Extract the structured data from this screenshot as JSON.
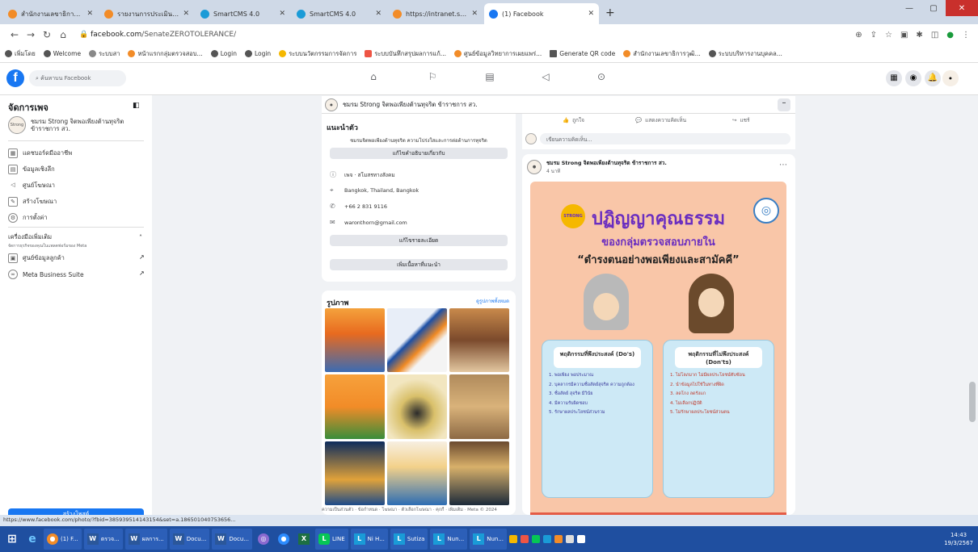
{
  "browser": {
    "tabs": [
      {
        "label": "สำนักงานเลขาธิการวุฒิสภา",
        "color": "#f28c28"
      },
      {
        "label": "รายงานการประเมินคุณธรรมและความโปร่งใส 2567",
        "color": "#f28c28"
      },
      {
        "label": "SmartCMS 4.0",
        "color": "#1a9bd7"
      },
      {
        "label": "SmartCMS 4.0",
        "color": "#1a9bd7"
      },
      {
        "label": "https://intranet.senate.go.th/...",
        "color": "#f28c28"
      },
      {
        "label": "(1) Facebook",
        "color": "#1877f2"
      }
    ],
    "url_domain": "facebook.com",
    "url_path": "/SenateZEROTOLERANCE/",
    "bookmarks": [
      {
        "label": "เพิ่มโดย",
        "color": "#555"
      },
      {
        "label": "Welcome",
        "color": "#555"
      },
      {
        "label": "ระบบสา",
        "color": "#888"
      },
      {
        "label": "หน้าแรกกลุ่มตรวจสอบ...",
        "color": "#f28c28"
      },
      {
        "label": "Login",
        "color": "#555"
      },
      {
        "label": "Login",
        "color": "#555"
      },
      {
        "label": "ระบบนวัตกรรมการจัดการ",
        "color": "#f5b800"
      },
      {
        "label": "ระบบบันทึกสรุปผลการแก้...",
        "color": "#e54"
      },
      {
        "label": "ศูนย์ข้อมูลวิทยาการเผยแพร่...",
        "color": "#f28c28"
      },
      {
        "label": "Generate QR code",
        "color": "#555"
      },
      {
        "label": "สำนักงานเลขาธิการวุฒิ...",
        "color": "#f28c28"
      },
      {
        "label": "ระบบบริหารงานบุคคล...",
        "color": "#555"
      }
    ]
  },
  "fb": {
    "logo": "f",
    "search_placeholder": "ค้นหาบน Facebook",
    "left": {
      "title": "จัดการเพจ",
      "page_name": "ชมรม Strong จิตพอเพียงต้านทุจริต ข้าราชการ สว.",
      "avatar_text": "Strong",
      "items": [
        {
          "label": "แดชบอร์ดมืออาชีพ",
          "icon": "▦"
        },
        {
          "label": "ข้อมูลเชิงลึก",
          "icon": "▤"
        },
        {
          "label": "ศูนย์โฆษณา",
          "icon": "◁"
        },
        {
          "label": "สร้างโฆษณา",
          "icon": "✎"
        },
        {
          "label": "การตั้งค่า",
          "icon": "⚙"
        }
      ],
      "more_tools": "เครื่องมือเพิ่มเติม",
      "more_tools_sub": "จัดการธุรกิจของคุณในแพลตฟอร์มของ Meta",
      "business_centre": "ศูนย์ข้อมูลลูกค้า",
      "meta_suite": "Meta Business Suite",
      "pro_button": "สร้างโพสต์"
    },
    "banner_name": "ชมรม Strong จิตพอเพียงต้านทุจริต ข้าราชการ สว.",
    "intro": {
      "title": "แนะนำตัว",
      "bio": "ชมรมจิตพอเพียงต้านทุจริต ความโปร่งใสและการต่อต้านการทุจริต",
      "edit_bio": "แก้ไขคำอธิบายเกี่ยวกับ",
      "category": "เพจ · สโมสรทางสังคม",
      "location": "Bangkok, Thailand, Bangkok",
      "phone": "+66 2 831 9116",
      "email": "waronthorn@gmail.com",
      "edit_details": "แก้ไขรายละเอียด",
      "add_featured": "เพิ่มเนื้อหาที่แนะนำ"
    },
    "photos": {
      "title": "รูปภาพ",
      "see_all": "ดูรูปภาพทั้งหมด"
    },
    "footer_text": "ความเป็นส่วนตัว · ข้อกำหนด · โฆษณา · ตัวเลือกโฆษณา · คุกกี้ · เพิ่มเติม · Meta © 2024",
    "composer": {
      "like": "ถูกใจ",
      "comment": "แสดงความคิดเห็น",
      "share": "แชร์",
      "comment_placeholder": "เขียนความคิดเห็น..."
    },
    "post": {
      "author": "ชมรม Strong จิตพอเพียงต้านทุจริต ข้าราชการ สว.",
      "time": "4 นาที",
      "headline": "ปฏิญญาคุณธรรม",
      "sub1": "ของกลุ่มตรวจสอบภายใน",
      "sub2": "“ดำรงตนอย่างพอเพียงและสามัคคี”",
      "dos_title": "พฤติกรรมที่พึงประสงค์ (Do's)",
      "dos": [
        "1. พอเพียง พอประมาณ",
        "2. บุคลากรมีความซื่อสัตย์สุจริต ความถูกต้อง",
        "3. ซื่อสัตย์ สุจริต มีวินัย",
        "4. มีความรับผิดชอบ",
        "5. รักษาผลประโยชน์ส่วนรวม"
      ],
      "donts_title": "พฤติกรรมที่ไม่พึงประสงค์ (Don'ts)",
      "donts": [
        "1. ไม่โลภมาก ไม่มีผลประโยชน์ทับซ้อน",
        "2. นำข้อมูลไปใช้ในทางที่ผิด",
        "3. ลดโกง ลดรังแก",
        "4. ไม่เลือกปฏิบัติ",
        "5. ไม่รักษาผลประโยชน์ส่วนตน"
      ]
    }
  },
  "status_url": "https://www.facebook.com/photo/?fbid=385939514143154&set=a.186501040753656...",
  "taskbar": {
    "items": [
      {
        "label": "(1) F...",
        "color": "#f28c28",
        "icon": "●"
      },
      {
        "label": "ตรวจ...",
        "color": "#2b579a",
        "icon": "W"
      },
      {
        "label": "ผลการ...",
        "color": "#2b579a",
        "icon": "W"
      },
      {
        "label": "Docu...",
        "color": "#2b579a",
        "icon": "W"
      },
      {
        "label": "Docu...",
        "color": "#2b579a",
        "icon": "W"
      },
      {
        "label": "LINE",
        "color": "#06c755",
        "icon": "L"
      },
      {
        "label": "Ni H...",
        "color": "#1a9bd7",
        "icon": "L"
      },
      {
        "label": "Sutiza",
        "color": "#1a9bd7",
        "icon": "L"
      },
      {
        "label": "Nun...",
        "color": "#1a9bd7",
        "icon": "L"
      },
      {
        "label": "Nun...",
        "color": "#1a9bd7",
        "icon": "L"
      }
    ],
    "time": "14:43",
    "date": "19/3/2567"
  }
}
